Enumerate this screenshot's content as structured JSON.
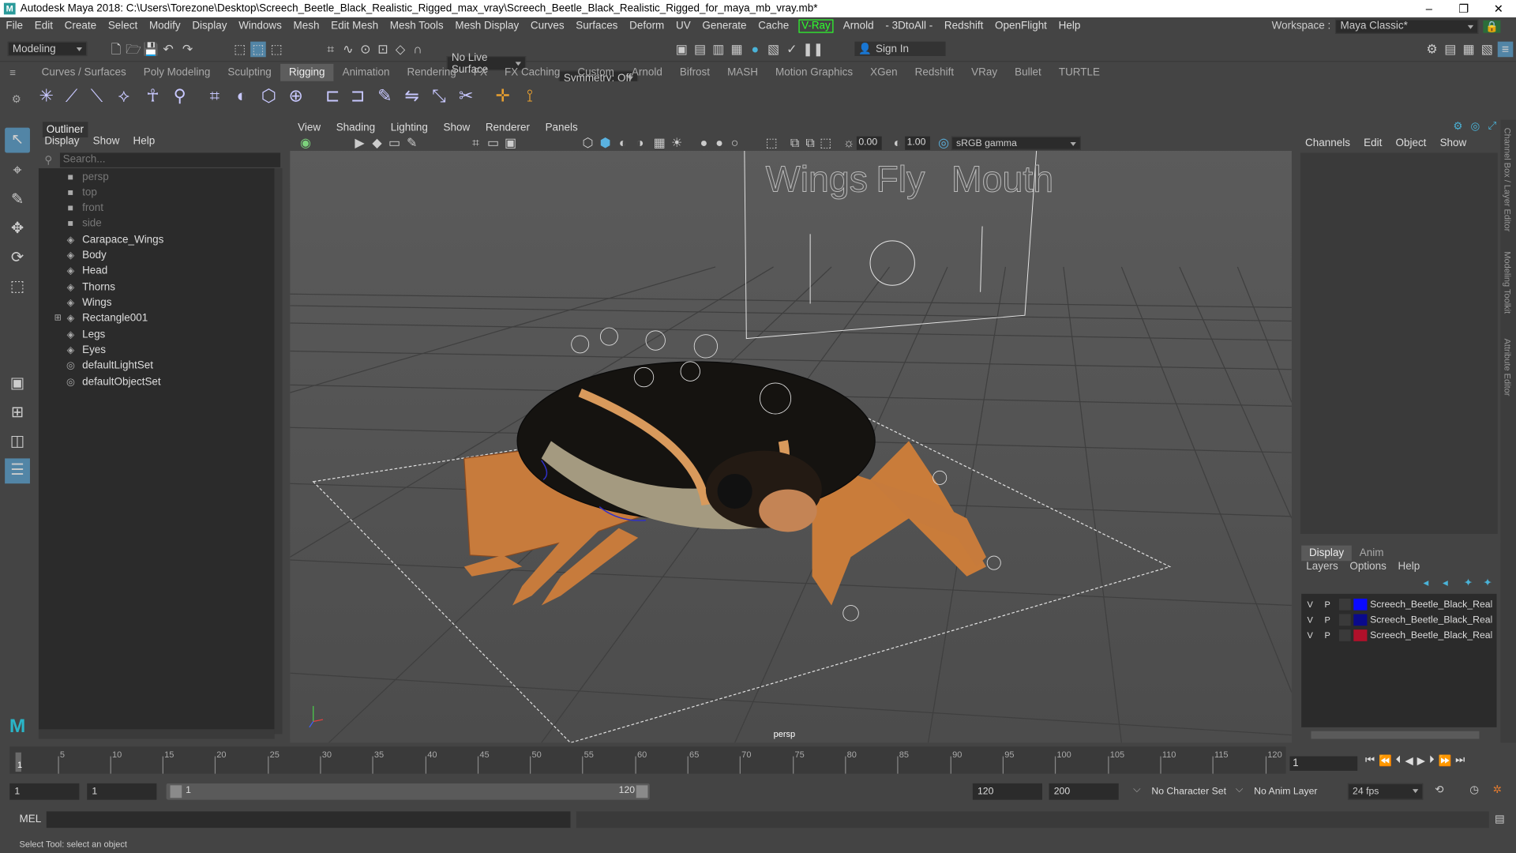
{
  "window": {
    "title": "Autodesk Maya 2018: C:\\Users\\Torezone\\Desktop\\Screech_Beetle_Black_Realistic_Rigged_max_vray\\Screech_Beetle_Black_Realistic_Rigged_for_maya_mb_vray.mb*",
    "logo": "M"
  },
  "menubar": {
    "items": [
      "File",
      "Edit",
      "Create",
      "Select",
      "Modify",
      "Display",
      "Windows",
      "Mesh",
      "Edit Mesh",
      "Mesh Tools",
      "Mesh Display",
      "Curves",
      "Surfaces",
      "Deform",
      "UV",
      "Generate",
      "Cache"
    ],
    "vray": "V-Ray",
    "items2": [
      "Arnold",
      "- 3DtoAll -",
      "Redshift",
      "OpenFlight",
      "Help"
    ],
    "workspace_label": "Workspace :",
    "workspace_value": "Maya Classic*"
  },
  "statusline": {
    "mode": "Modeling",
    "live_surface": "No Live Surface",
    "symmetry": "Symmetry: Off",
    "sign_in": "Sign In"
  },
  "shelf": {
    "tabs": [
      "Curves / Surfaces",
      "Poly Modeling",
      "Sculpting",
      "Rigging",
      "Animation",
      "Rendering",
      "FX",
      "FX Caching",
      "Custom",
      "Arnold",
      "Bifrost",
      "MASH",
      "Motion Graphics",
      "XGen",
      "Redshift",
      "VRay",
      "Bullet",
      "TURTLE"
    ],
    "active_tab": "Rigging"
  },
  "outliner": {
    "title": "Outliner",
    "menus": [
      "Display",
      "Show",
      "Help"
    ],
    "search_placeholder": "Search...",
    "items": [
      {
        "label": "persp",
        "type": "camera"
      },
      {
        "label": "top",
        "type": "camera"
      },
      {
        "label": "front",
        "type": "camera"
      },
      {
        "label": "side",
        "type": "camera"
      },
      {
        "label": "Carapace_Wings",
        "type": "mesh"
      },
      {
        "label": "Body",
        "type": "mesh"
      },
      {
        "label": "Head",
        "type": "mesh"
      },
      {
        "label": "Thorns",
        "type": "mesh"
      },
      {
        "label": "Wings",
        "type": "mesh"
      },
      {
        "label": "Rectangle001",
        "type": "group"
      },
      {
        "label": "Legs",
        "type": "mesh"
      },
      {
        "label": "Eyes",
        "type": "mesh"
      },
      {
        "label": "defaultLightSet",
        "type": "set"
      },
      {
        "label": "defaultObjectSet",
        "type": "set"
      }
    ]
  },
  "viewport": {
    "menus": [
      "View",
      "Shading",
      "Lighting",
      "Show",
      "Renderer",
      "Panels"
    ],
    "exposure": "0.00",
    "gamma": "1.00",
    "color_space": "sRGB gamma",
    "camera_label": "persp",
    "control_labels": [
      "Wings",
      "Fly",
      "Mouth"
    ]
  },
  "channelbox": {
    "menus": [
      "Channels",
      "Edit",
      "Object",
      "Show"
    ],
    "side_tabs": [
      "Channel Box / Layer Editor",
      "Modeling Toolkit",
      "Attribute Editor"
    ]
  },
  "layers": {
    "tabs": [
      "Display",
      "Anim"
    ],
    "active_tab": "Display",
    "menus": [
      "Layers",
      "Options",
      "Help"
    ],
    "rows": [
      {
        "v": "V",
        "p": "P",
        "name": "Screech_Beetle_Black_Realistic_",
        "color": "#0a0aff"
      },
      {
        "v": "V",
        "p": "P",
        "name": "Screech_Beetle_Black_Realistic_",
        "color": "#0a0a8c"
      },
      {
        "v": "V",
        "p": "P",
        "name": "Screech_Beetle_Black_Realistic_",
        "color": "#b0102a"
      }
    ]
  },
  "timeline": {
    "ticks": [
      "1",
      "5",
      "10",
      "15",
      "20",
      "25",
      "30",
      "35",
      "40",
      "45",
      "50",
      "55",
      "60",
      "65",
      "70",
      "75",
      "80",
      "85",
      "90",
      "95",
      "100",
      "105",
      "110",
      "115",
      "120"
    ],
    "current_frame": "1"
  },
  "range": {
    "start": "1",
    "start_inner": "1",
    "slider_start": "1",
    "slider_end": "120",
    "end_inner": "120",
    "end": "200",
    "character_set": "No Character Set",
    "anim_layer": "No Anim Layer",
    "fps": "24 fps"
  },
  "command": {
    "label": "MEL"
  },
  "help_line": {
    "text": "Select Tool: select an object"
  }
}
